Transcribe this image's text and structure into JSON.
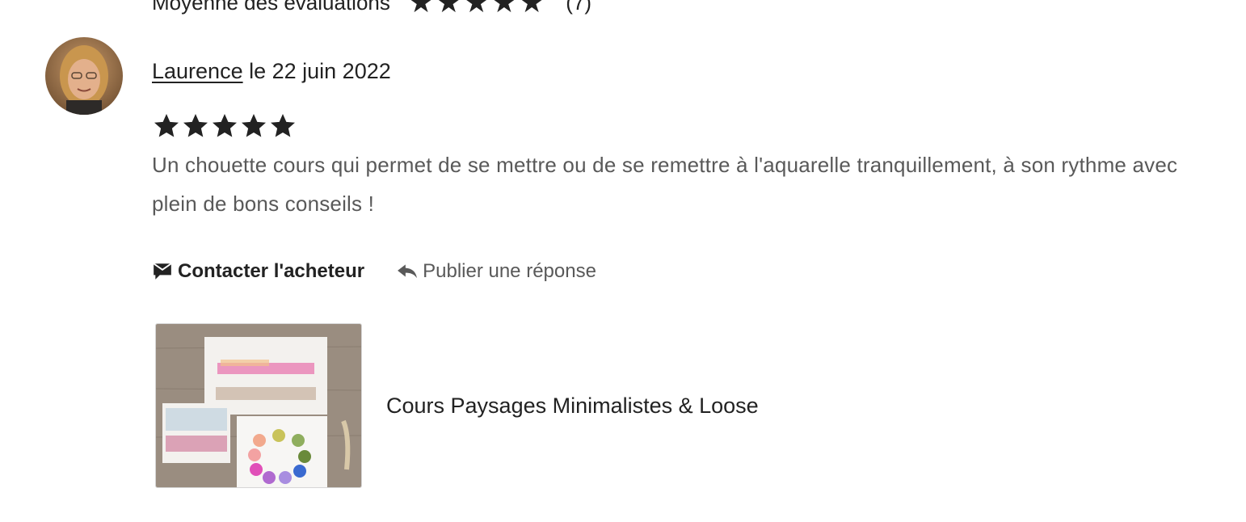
{
  "summary": {
    "label": "Moyenne des évaluations",
    "rating": 5,
    "count_text": "(7)"
  },
  "review": {
    "reviewer_name": "Laurence",
    "date_text": " le 22 juin 2022",
    "rating": 5,
    "text": "Un chouette cours qui permet de se mettre ou de se remettre à l'aquarelle tranquillement, à son rythme avec plein de bons conseils !"
  },
  "actions": {
    "contact_label": "Contacter l'acheteur",
    "reply_label": "Publier une réponse"
  },
  "product": {
    "title": "Cours Paysages Minimalistes & Loose"
  },
  "icons": {
    "star": "star-icon",
    "contact": "message-icon",
    "reply": "reply-arrow-icon"
  }
}
